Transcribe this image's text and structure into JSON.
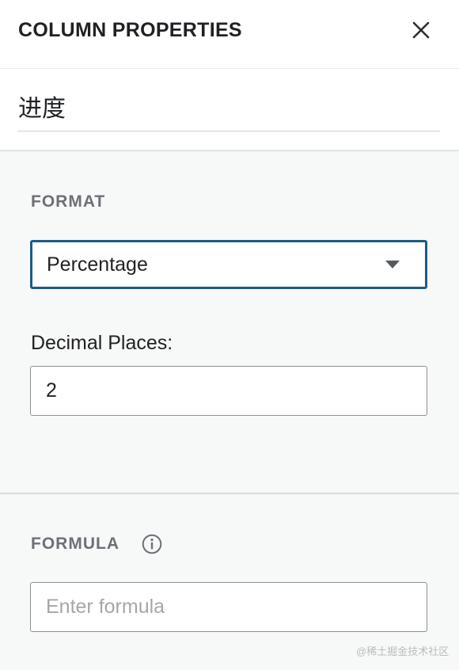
{
  "panel": {
    "title": "COLUMN PROPERTIES",
    "column_name": "进度"
  },
  "format": {
    "section_label": "FORMAT",
    "selected": "Percentage",
    "decimal_label": "Decimal Places:",
    "decimal_value": "2"
  },
  "formula": {
    "section_label": "FORMULA",
    "placeholder": "Enter formula",
    "value": ""
  },
  "watermark": "@稀土掘金技术社区",
  "icons": [
    "close-icon",
    "chevron-down-icon",
    "info-icon"
  ],
  "colors": {
    "accent_border": "#1d5c86",
    "section_label": "#6c7176",
    "panel_background": "#f7f8f8"
  }
}
